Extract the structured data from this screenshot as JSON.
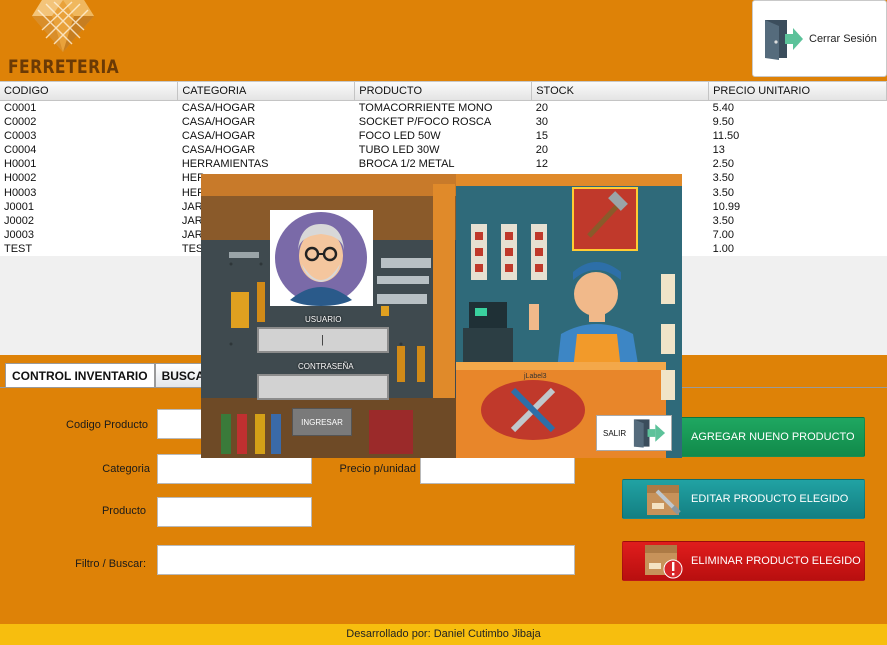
{
  "header": {
    "logo_text": "FERRETERIA",
    "logout_label": "Cerrar Sesión"
  },
  "table": {
    "columns": [
      "CODIGO",
      "CATEGORIA",
      "PRODUCTO",
      "STOCK",
      "PRECIO UNITARIO"
    ],
    "rows": [
      [
        "C0001",
        "CASA/HOGAR",
        "TOMACORRIENTE MONO",
        "20",
        "5.40"
      ],
      [
        "C0002",
        "CASA/HOGAR",
        "SOCKET P/FOCO ROSCA",
        "30",
        "9.50"
      ],
      [
        "C0003",
        "CASA/HOGAR",
        "FOCO LED 50W",
        "15",
        "11.50"
      ],
      [
        "C0004",
        "CASA/HOGAR",
        "TUBO LED 30W",
        "20",
        "13"
      ],
      [
        "H0001",
        "HERRAMIENTAS",
        "BROCA 1/2 METAL",
        "12",
        "2.50"
      ],
      [
        "H0002",
        "HER",
        "",
        "",
        "3.50"
      ],
      [
        "H0003",
        "HER",
        "",
        "",
        "3.50"
      ],
      [
        "J0001",
        "JAR",
        "",
        "",
        "10.99"
      ],
      [
        "J0002",
        "JAR",
        "",
        "",
        "3.50"
      ],
      [
        "J0003",
        "JAR",
        "",
        "",
        "7.00"
      ],
      [
        "TEST",
        "TES",
        "",
        "",
        "1.00"
      ]
    ]
  },
  "tabs": [
    "CONTROL INVENTARIO",
    "BUSCA"
  ],
  "form": {
    "codigo_label": "Codigo Producto",
    "categoria_label": "Categoria",
    "producto_label": "Producto",
    "precio_label": "Precio p/unidad",
    "filtro_label": "Filtro / Buscar:"
  },
  "buttons": {
    "add": "AGREGAR NUENO PRODUCTO",
    "edit": "EDITAR PRODUCTO ELEGIDO",
    "delete": "ELIMINAR PRODUCTO ELEGIDO"
  },
  "login": {
    "usuario_label": "USUARIO",
    "usuario_value": "|",
    "password_label": "CONTRASEÑA",
    "ingresar_label": "INGRESAR",
    "label3": "jLabel3",
    "salir_label": "SALIR"
  },
  "footer": "Desarrollado por: Daniel Cutimbo Jibaja",
  "colors": {
    "background": "#DE8207",
    "footer": "#F7BE0E",
    "add": "#18994F",
    "edit": "#1A9193",
    "delete": "#CC1515"
  }
}
